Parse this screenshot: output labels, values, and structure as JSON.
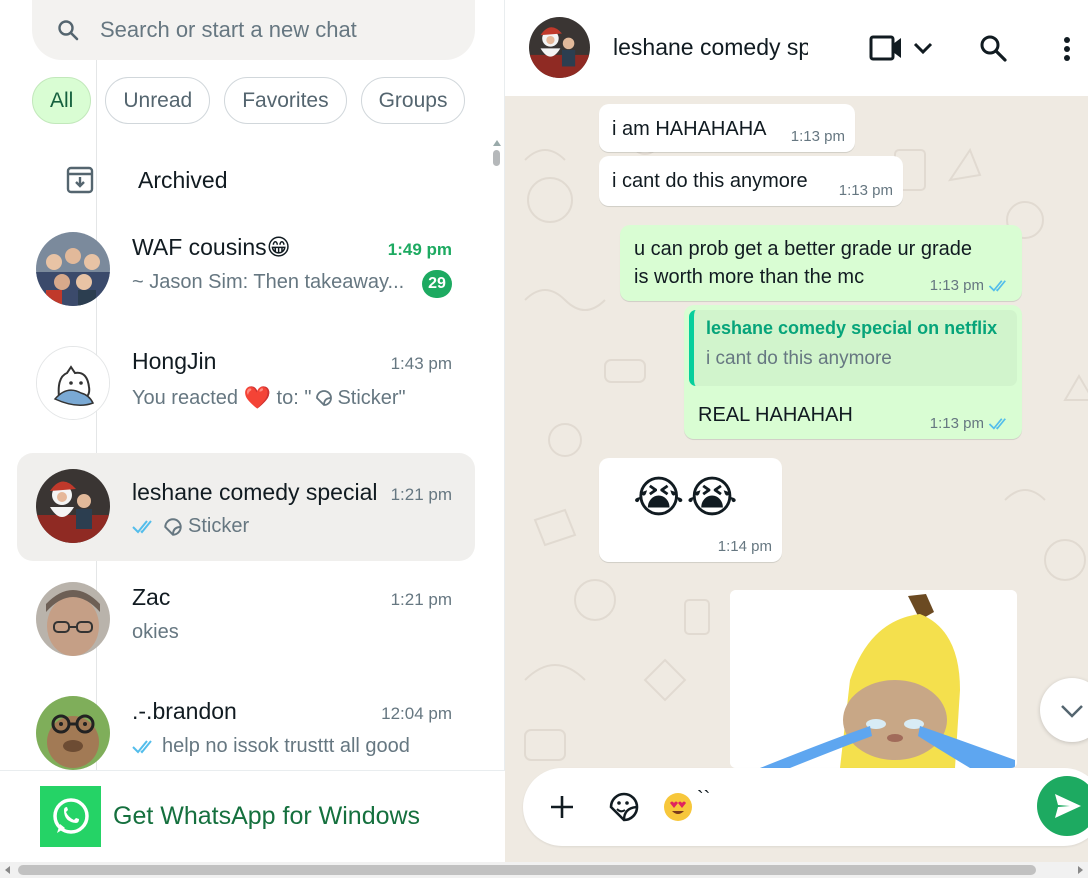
{
  "search": {
    "placeholder": "Search or start a new chat"
  },
  "filters": [
    {
      "label": "All",
      "active": true
    },
    {
      "label": "Unread",
      "active": false
    },
    {
      "label": "Favorites",
      "active": false
    },
    {
      "label": "Groups",
      "active": false
    }
  ],
  "archived": {
    "label": "Archived"
  },
  "chats": [
    {
      "name": "WAF cousins😁",
      "time": "1:49 pm",
      "preview": "~ Jason Sim: Then takeaway...",
      "unread": "29"
    },
    {
      "name": "HongJin",
      "time": "1:43 pm",
      "preview_prefix": "You reacted ",
      "preview_emoji": "❤️",
      "preview_suffix": " to: \"",
      "preview_tail": "Sticker\""
    },
    {
      "name": "leshane comedy special",
      "time": "1:21 pm",
      "preview": "Sticker",
      "selected": true
    },
    {
      "name": "Zac",
      "time": "1:21 pm",
      "preview": "okies"
    },
    {
      "name": ".-.brandon",
      "time": "12:04 pm",
      "preview": "help no issok trusttt all good"
    }
  ],
  "get_app": {
    "label": "Get WhatsApp for Windows"
  },
  "conversation": {
    "title": "leshane comedy sp",
    "messages": [
      {
        "dir": "in",
        "text": "i am HAHAHAHA",
        "time": "1:13 pm"
      },
      {
        "dir": "in",
        "text": "i cant do this anymore",
        "time": "1:13 pm"
      },
      {
        "dir": "out",
        "text_line1": "u can prob get a better grade ur grade",
        "text_line2": "is worth more than the mc",
        "time": "1:13 pm"
      },
      {
        "dir": "out",
        "quote_name": "leshane comedy special on netflix",
        "quote_text": "i cant do this anymore",
        "text": "REAL HAHAHAH",
        "time": "1:13 pm"
      },
      {
        "dir": "in",
        "text": "😭😭",
        "time": "1:14 pm"
      }
    ]
  },
  "compose": {
    "draft": "``"
  },
  "colors": {
    "accent": "#1daa61",
    "outgoing": "#d9fdd3",
    "chat_bg": "#efeae2",
    "read_ticks": "#53bdeb"
  }
}
